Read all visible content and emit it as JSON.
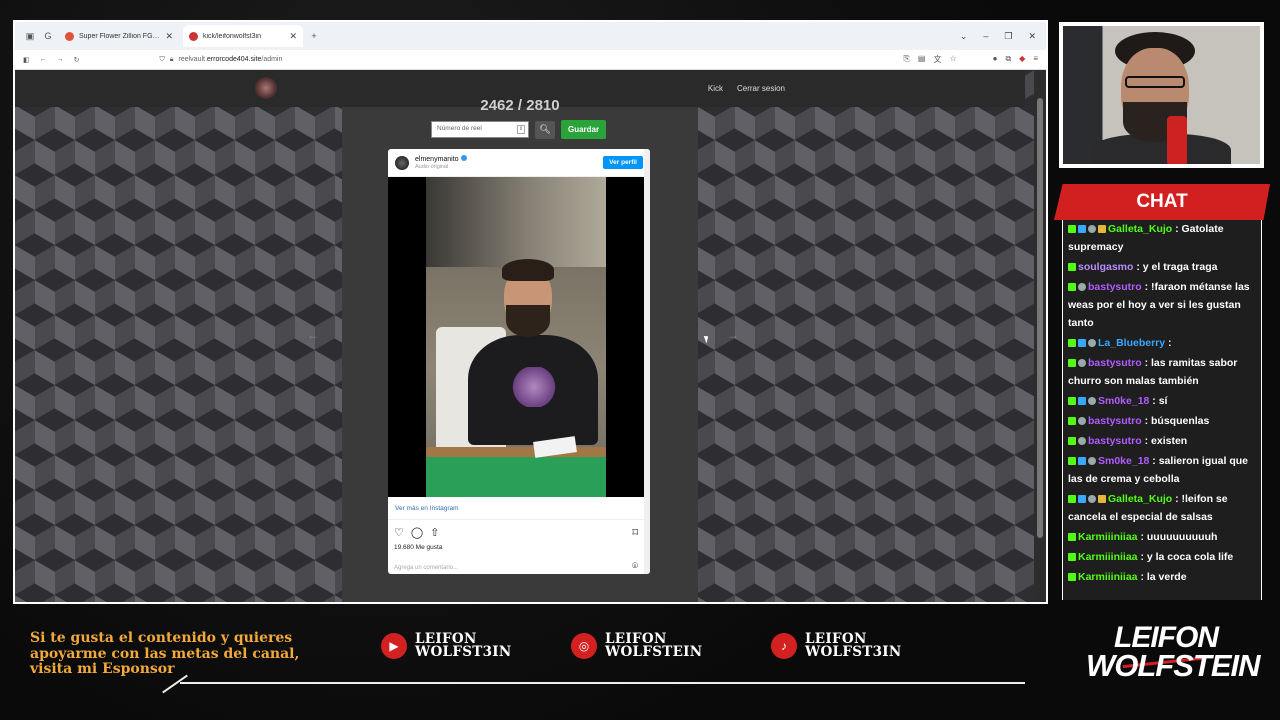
{
  "browser": {
    "tabs": [
      {
        "title": "Super Flower Zillion FG (SF-125",
        "active": false
      },
      {
        "title": "kick/leifonwolfst3in",
        "active": true
      }
    ],
    "url_prefix": "reelvault.",
    "url_domain": "errorcode404.site",
    "url_path": "/admin"
  },
  "site": {
    "nav": {
      "kick": "Kick",
      "logout": "Cerrar sesion"
    },
    "counter": "2462 / 2810",
    "reel_input_placeholder": "Número de reel",
    "save_label": "Guardar"
  },
  "instagram": {
    "username": "elmenymanito",
    "audio": "Audio original",
    "view_profile": "Ver perfil",
    "see_more": "Ver más en Instagram",
    "likes": "19.680 Me gusta",
    "comment_placeholder": "Agrega un comentario..."
  },
  "chat": {
    "title": "CHAT",
    "messages": [
      {
        "user": "Galleta_Kujo",
        "color": "#53fc18",
        "text": " : Gatolate supremacy",
        "badges": [
          "b-green",
          "b-blue",
          "b-gray",
          "b-gold"
        ]
      },
      {
        "user": "soulgasmo",
        "color": "#b98cff",
        "text": " : y el traga traga",
        "badges": [
          "b-green"
        ]
      },
      {
        "user": "bastysutro",
        "color": "#b05cff",
        "text": " : !faraon métanse las weas por el hoy a ver si les gustan tanto",
        "badges": [
          "b-green",
          "b-gray"
        ]
      },
      {
        "user": "La_Blueberry",
        "color": "#3aa7ff",
        "text": " : ",
        "badges": [
          "b-green",
          "b-blue",
          "b-gray"
        ]
      },
      {
        "user": "bastysutro",
        "color": "#b05cff",
        "text": " : las ramitas sabor churro son malas también",
        "badges": [
          "b-green",
          "b-gray"
        ]
      },
      {
        "user": "Sm0ke_18",
        "color": "#b05cff",
        "text": " : sí",
        "badges": [
          "b-green",
          "b-blue",
          "b-gray"
        ]
      },
      {
        "user": "bastysutro",
        "color": "#b05cff",
        "text": " : búsquenlas",
        "badges": [
          "b-green",
          "b-gray"
        ]
      },
      {
        "user": "bastysutro",
        "color": "#b05cff",
        "text": " : existen",
        "badges": [
          "b-green",
          "b-gray"
        ]
      },
      {
        "user": "Sm0ke_18",
        "color": "#b05cff",
        "text": " : salieron igual que las de crema y cebolla",
        "badges": [
          "b-green",
          "b-blue",
          "b-gray"
        ]
      },
      {
        "user": "Galleta_Kujo",
        "color": "#53fc18",
        "text": " : !leifon se cancela el especial de salsas",
        "badges": [
          "b-green",
          "b-blue",
          "b-gray",
          "b-gold"
        ]
      },
      {
        "user": "Karmiiiniiaa",
        "color": "#53fc18",
        "text": " : uuuuuuuuuuh",
        "badges": [
          "b-green"
        ]
      },
      {
        "user": "Karmiiiniiaa",
        "color": "#53fc18",
        "text": " : y la coca cola life",
        "badges": [
          "b-green"
        ]
      },
      {
        "user": "Karmiiiniiaa",
        "color": "#53fc18",
        "text": " : la verde",
        "badges": [
          "b-green"
        ]
      }
    ]
  },
  "overlay": {
    "sponsor_text": "Si te gusta el contenido y quieres apoyarme con las metas del canal, visita mi Esponsor",
    "socials": [
      {
        "platform": "youtube-icon",
        "glyph": "▶",
        "line1": "LEIFON",
        "line2": "WOLFST3IN"
      },
      {
        "platform": "instagram-icon",
        "glyph": "◎",
        "line1": "LEIFON",
        "line2": "WOLFSTEIN"
      },
      {
        "platform": "tiktok-icon",
        "glyph": "♪",
        "line1": "LEIFON",
        "line2": "WOLFST3IN"
      }
    ],
    "brand_line1": "LEIFON",
    "brand_line2": "WOLFSTEIN"
  }
}
